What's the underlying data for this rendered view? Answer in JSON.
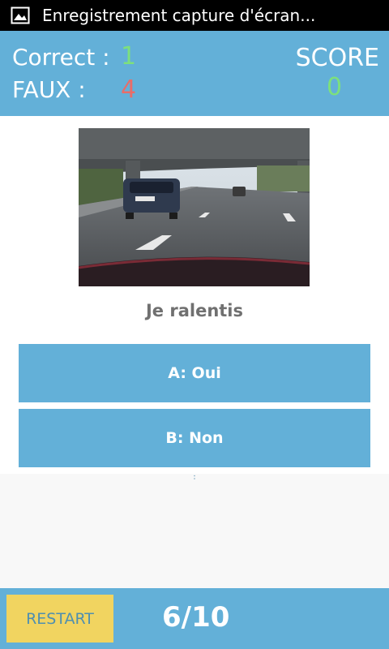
{
  "status_bar": {
    "icon": "image-icon",
    "text": "Enregistrement capture d'écran..."
  },
  "header": {
    "correct_label": "Correct :",
    "correct_value": "1",
    "faux_label": "FAUX :",
    "faux_value": "4",
    "score_label": "SCORE",
    "score_value": "0"
  },
  "quiz": {
    "question": "Je ralentis",
    "answers": [
      {
        "label": "A: Oui"
      },
      {
        "label": "B: Non"
      }
    ]
  },
  "footer": {
    "restart_label": "RESTART",
    "progress": "6/10"
  },
  "colors": {
    "primary": "#63b0d8",
    "correct": "#7de07c",
    "wrong": "#e86d69",
    "restart_bg": "#f1d460"
  }
}
